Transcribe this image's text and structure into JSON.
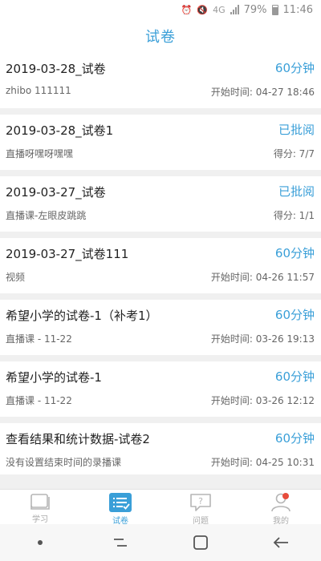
{
  "status_bar": {
    "network": "4G",
    "battery": "79%",
    "time": "11:46"
  },
  "header": {
    "title": "试卷"
  },
  "papers": [
    {
      "title": "2019-03-28_试卷",
      "status": "60分钟",
      "subtitle": "zhibo 111111",
      "info": "开始时间: 04-27 18:46"
    },
    {
      "title": "2019-03-28_试卷1",
      "status": "已批阅",
      "subtitle": "直播呀嘿呀嘿嘿",
      "info": "得分: 7/7"
    },
    {
      "title": "2019-03-27_试卷",
      "status": "已批阅",
      "subtitle": "直播课-左眼皮跳跳",
      "info": "得分: 1/1"
    },
    {
      "title": "2019-03-27_试卷111",
      "status": "60分钟",
      "subtitle": "视频",
      "info": "开始时间: 04-26 11:57"
    },
    {
      "title": "希望小学的试卷-1（补考1）",
      "status": "60分钟",
      "subtitle": "直播课 - 11-22",
      "info": "开始时间: 03-26 19:13"
    },
    {
      "title": "希望小学的试卷-1",
      "status": "60分钟",
      "subtitle": "直播课 - 11-22",
      "info": "开始时间: 03-26 12:12"
    },
    {
      "title": "查看结果和统计数据-试卷2",
      "status": "60分钟",
      "subtitle": "没有设置结束时间的录播课",
      "info": "开始时间: 04-25 10:31"
    }
  ],
  "tabs": [
    {
      "label": "学习",
      "icon": "book-icon"
    },
    {
      "label": "试卷",
      "icon": "exam-list-icon",
      "active": true
    },
    {
      "label": "问题",
      "icon": "question-bubble-icon"
    },
    {
      "label": "我的",
      "icon": "profile-icon"
    }
  ],
  "colors": {
    "accent": "#3a9fd8",
    "badge": "#e74c3c"
  }
}
